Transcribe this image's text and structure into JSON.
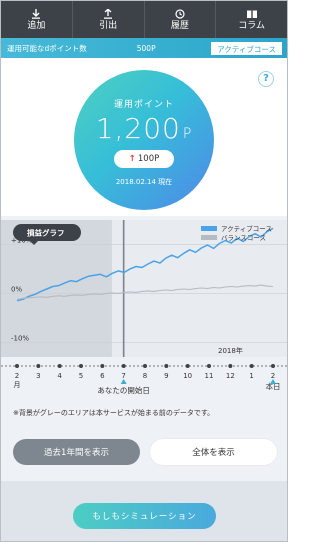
{
  "tabs": [
    {
      "label": "追加",
      "icon": "download-icon"
    },
    {
      "label": "引出",
      "icon": "upload-icon"
    },
    {
      "label": "履歴",
      "icon": "history-icon"
    },
    {
      "label": "コラム",
      "icon": "book-icon"
    }
  ],
  "strip": {
    "label": "運用可能なdポイント数",
    "value": "500P",
    "course": "アクティブコース"
  },
  "hero": {
    "help": "?",
    "title": "運用ポイント",
    "points": "1,200",
    "unit": "P",
    "change": "100P",
    "date": "2018.02.14 現在"
  },
  "chart_data": {
    "type": "line",
    "title": "損益グラフ",
    "y_ticks": [
      "+10%",
      "0%",
      "-10%"
    ],
    "ylim": [
      -13,
      15
    ],
    "x_ticks": [
      "2",
      "3",
      "4",
      "5",
      "6",
      "7",
      "8",
      "9",
      "10",
      "11",
      "12",
      "1",
      "2"
    ],
    "x_first_sub": "月",
    "x_last_sub": "本日",
    "year_label": "2018年",
    "start_marker_label": "あなたの開始日",
    "start_index": 5,
    "grey_until_index": 5,
    "series": [
      {
        "name": "アクティブコース",
        "color": "#4aa3e6",
        "values": [
          -1.5,
          -1.2,
          -0.6,
          -0.2,
          0.4,
          0.9,
          1.4,
          1.6,
          2.1,
          2.6,
          2.4,
          3.0,
          3.5,
          3.7,
          3.9,
          3.4,
          4.1,
          4.6,
          4.3,
          5.0,
          5.5,
          5.3,
          6.0,
          6.6,
          6.2,
          7.2,
          7.8,
          7.3,
          8.2,
          8.9,
          8.4,
          9.3,
          9.9,
          9.2,
          10.2,
          10.8,
          10.3,
          11.3,
          10.6,
          11.6,
          12.2,
          11.5,
          12.6,
          13.3
        ]
      },
      {
        "name": "バランスコース",
        "color": "#b5bbc2",
        "values": [
          -1.2,
          -1.0,
          -0.9,
          -0.8,
          -0.7,
          -0.8,
          -0.6,
          -0.5,
          -0.6,
          -0.4,
          -0.3,
          -0.4,
          -0.2,
          -0.1,
          -0.2,
          0.0,
          0.1,
          0.0,
          0.2,
          0.3,
          0.2,
          0.4,
          0.5,
          0.4,
          0.6,
          0.7,
          0.6,
          0.8,
          0.9,
          0.8,
          1.0,
          1.1,
          1.0,
          1.2,
          1.1,
          1.3,
          1.4,
          1.3,
          1.5,
          1.6,
          1.5,
          1.7,
          1.5,
          1.4
        ]
      }
    ]
  },
  "note": "※背景がグレーのエリアは本サービスが始まる前のデータです。",
  "buttons": {
    "past_year": "過去1年間を表示",
    "show_all": "全体を表示"
  },
  "footer": {
    "simulation": "もしもシミュレーション"
  }
}
